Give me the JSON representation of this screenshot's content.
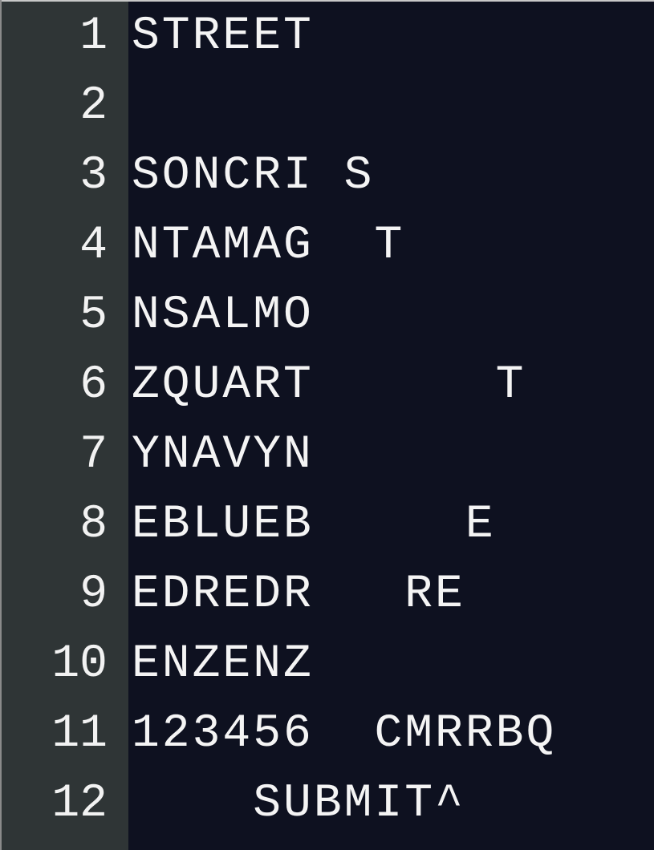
{
  "editor": {
    "lines": [
      {
        "number": "1",
        "text": "STREET"
      },
      {
        "number": "2",
        "text": ""
      },
      {
        "number": "3",
        "text": "SONCRI S"
      },
      {
        "number": "4",
        "text": "NTAMAG  T"
      },
      {
        "number": "5",
        "text": "NSALMO"
      },
      {
        "number": "6",
        "text": "ZQUART      T"
      },
      {
        "number": "7",
        "text": "YNAVYN"
      },
      {
        "number": "8",
        "text": "EBLUEB     E"
      },
      {
        "number": "9",
        "text": "EDREDR   RE"
      },
      {
        "number": "10",
        "text": "ENZENZ"
      },
      {
        "number": "11",
        "text": "123456  CMRRBQ"
      },
      {
        "number": "12",
        "text": "    SUBMIT^"
      }
    ]
  },
  "colors": {
    "background": "#0e1120",
    "gutter": "#2f3536",
    "text": "#f4f4f4"
  }
}
